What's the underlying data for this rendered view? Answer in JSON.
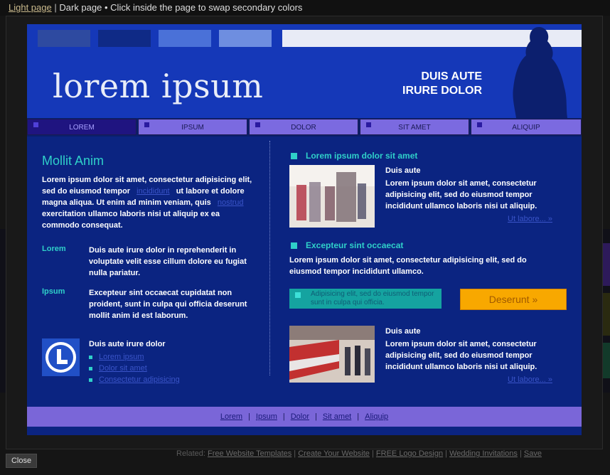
{
  "topbar": {
    "light_link": "Light page",
    "separator": "|",
    "dark_text": "Dark page",
    "bullet": "•",
    "hint": "Click inside the page to swap secondary colors"
  },
  "header": {
    "logo": "lorem ipsum",
    "tagline_line1": "DUIS AUTE",
    "tagline_line2": "IRURE DOLOR"
  },
  "nav": {
    "items": [
      {
        "label": "LOREM"
      },
      {
        "label": "IPSUM"
      },
      {
        "label": "DOLOR"
      },
      {
        "label": "SIT AMET"
      },
      {
        "label": "ALIQUIP"
      }
    ],
    "active_index": 0
  },
  "left": {
    "title": "Mollit Anim",
    "para_part1": "Lorem ipsum dolor sit amet, consectetur adipisicing elit, sed do eiusmod tempor",
    "link1": "incididunt",
    "para_part2": "ut labore et dolore magna aliqua. Ut enim ad minim veniam, quis",
    "link2": "nostrud",
    "para_part3": "exercitation ullamco laboris nisi ut aliquip ex ea commodo consequat.",
    "def1_term": "Lorem",
    "def1_text": "Duis aute irure dolor in reprehenderit in voluptate velit esse cillum dolore eu fugiat nulla pariatur.",
    "def2_term": "Ipsum",
    "def2_text": "Excepteur sint occaecat cupidatat non proident, sunt in culpa qui officia deserunt mollit anim id est laborum.",
    "block_title": "Duis aute irure dolor",
    "block_links": [
      "Lorem ipsum",
      "Dolor sit amet",
      "Consectetur adipisicing"
    ]
  },
  "right": {
    "heading1": "Lorem ipsum dolor sit amet",
    "article1_title": "Duis aute",
    "article1_text": "Lorem ipsum dolor sit amet, consectetur adipisicing elit, sed do eiusmod tempor incididunt ullamco laboris nisi ut aliquip.",
    "article1_more": "Ut labore... »",
    "heading2": "Excepteur sint occaecat",
    "para2": "Lorem ipsum dolor sit amet, consectetur adipisicing elit, sed do eiusmod tempor incididunt ullamco.",
    "teal_text": "Adipisicing elit, sed do eiusmod tempor sunt in culpa qui officia.",
    "cta": "Deserunt »",
    "article2_title": "Duis aute",
    "article2_text": "Lorem ipsum dolor sit amet, consectetur adipisicing elit, sed do eiusmod tempor incididunt ullamco laboris nisi ut aliquip.",
    "article2_more": "Ut labore... »"
  },
  "footer": {
    "links": [
      "Lorem",
      "Ipsum",
      "Dolor",
      "Sit amet",
      "Aliquip"
    ],
    "separator": "|"
  },
  "lightbox": {
    "close": "Close",
    "related_label": "Related:",
    "related_links": [
      "Free Website Templates",
      "Create Your Website",
      "FREE Logo Design",
      "Wedding Invitations",
      "Save"
    ]
  },
  "colors": {
    "page_bg": "#0b2481",
    "header_bg": "#1538b8",
    "accent_teal": "#2fd0c9",
    "nav_purple": "#7b6ae0",
    "cta_orange": "#f8a800"
  }
}
